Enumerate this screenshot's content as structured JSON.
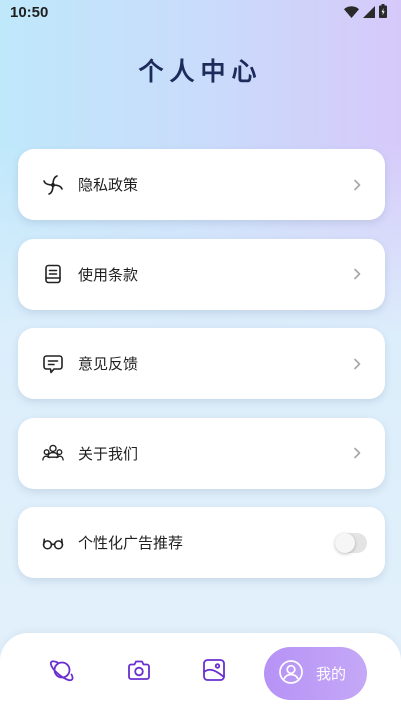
{
  "status_bar": {
    "time": "10:50",
    "icons": [
      "wifi-icon",
      "signal-icon",
      "battery-icon"
    ]
  },
  "header": {
    "title": "个人中心"
  },
  "menu": {
    "items": [
      {
        "label": "隐私政策",
        "icon": "pinwheel-icon",
        "trailing": "chevron"
      },
      {
        "label": "使用条款",
        "icon": "document-icon",
        "trailing": "chevron"
      },
      {
        "label": "意见反馈",
        "icon": "chat-bubble-icon",
        "trailing": "chevron"
      },
      {
        "label": "关于我们",
        "icon": "users-icon",
        "trailing": "chevron"
      },
      {
        "label": "个性化广告推荐",
        "icon": "glasses-icon",
        "trailing": "toggle",
        "toggle_on": false
      }
    ]
  },
  "tab_bar": {
    "tabs": [
      {
        "icon": "planet-icon"
      },
      {
        "icon": "camera-icon"
      },
      {
        "icon": "photo-icon"
      },
      {
        "icon": "user-icon",
        "label": "我的",
        "active": true
      }
    ]
  },
  "colors": {
    "accent": "#b692f6",
    "icon_purple": "#6a2fd0",
    "title": "#1d2b5a"
  }
}
